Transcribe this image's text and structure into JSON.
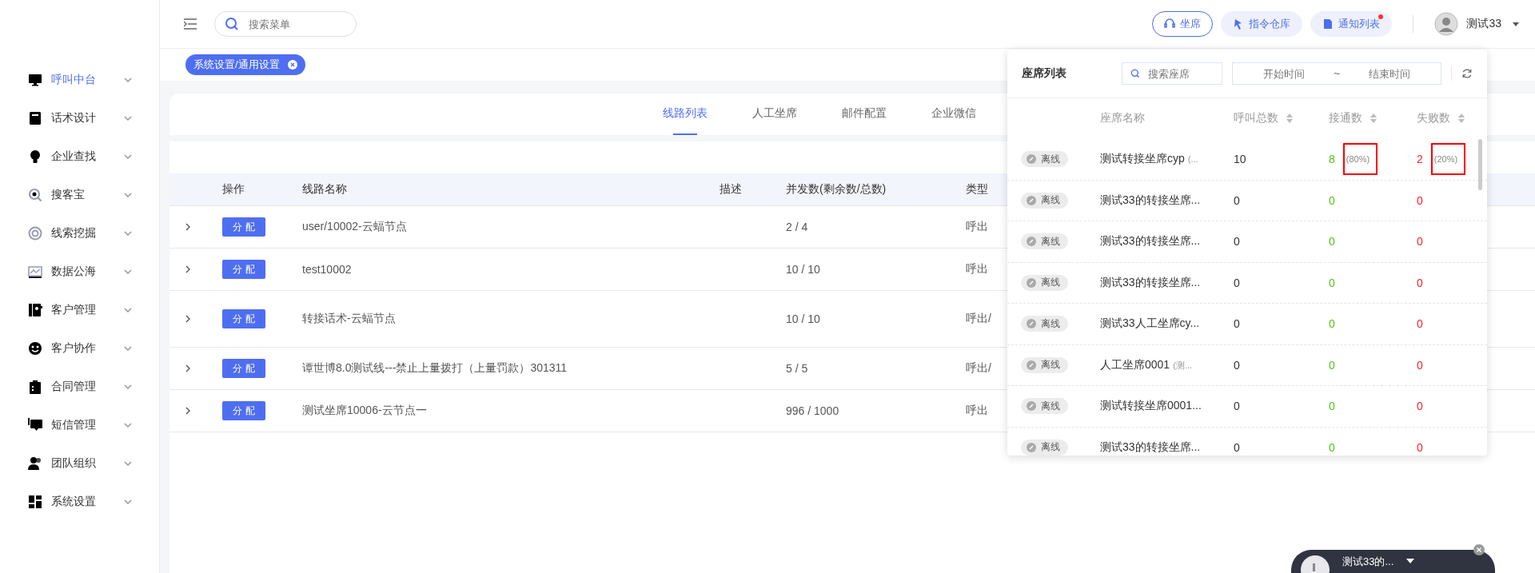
{
  "sidebar": {
    "items": [
      {
        "label": "呼叫中台",
        "selected": true
      },
      {
        "label": "话术设计",
        "selected": false
      },
      {
        "label": "企业查找",
        "selected": false
      },
      {
        "label": "搜客宝",
        "selected": false
      },
      {
        "label": "线索挖掘",
        "selected": false
      },
      {
        "label": "数据公海",
        "selected": false
      },
      {
        "label": "客户管理",
        "selected": false
      },
      {
        "label": "客户协作",
        "selected": false
      },
      {
        "label": "合同管理",
        "selected": false
      },
      {
        "label": "短信管理",
        "selected": false
      },
      {
        "label": "团队组织",
        "selected": false
      },
      {
        "label": "系统设置",
        "selected": false
      }
    ]
  },
  "header": {
    "search": {
      "placeholder": "搜索菜单"
    },
    "buttons": [
      {
        "label": "坐席",
        "selected": true,
        "dot": false
      },
      {
        "label": "指令仓库",
        "selected": false,
        "dot": false
      },
      {
        "label": "通知列表",
        "selected": false,
        "dot": true
      }
    ],
    "user": "测试33"
  },
  "tag": {
    "label": "系统设置/通用设置"
  },
  "tabs": [
    {
      "label": "线路列表",
      "selected": true
    },
    {
      "label": "人工坐席",
      "selected": false
    },
    {
      "label": "邮件配置",
      "selected": false
    },
    {
      "label": "企业微信",
      "selected": false
    }
  ],
  "table": {
    "columns": [
      "操作",
      "线路名称",
      "描述",
      "并发数(剩余数/总数)",
      "类型"
    ],
    "rows": [
      {
        "action": "分 配",
        "name": "user/10002-云蝠节点",
        "description": "",
        "concurrency": "2 / 4",
        "type": "呼出"
      },
      {
        "action": "分 配",
        "name": "test10002",
        "description": "",
        "concurrency": "10 / 10",
        "type": "呼出"
      },
      {
        "action": "分 配",
        "name": "转接话术-云蝠节点",
        "description": "",
        "concurrency": "10 / 10",
        "type": "呼出/"
      },
      {
        "action": "分 配",
        "name": "谭世博8.0测试线---禁止上量拨打（上量罚款）301311",
        "description": "",
        "concurrency": "5 / 5",
        "type": "呼出/"
      },
      {
        "action": "分 配",
        "name": "测试坐席10006-云节点一",
        "description": "",
        "concurrency": "996 / 1000",
        "type": "呼出"
      }
    ]
  },
  "seat_popup": {
    "title": "座席列表",
    "search": {
      "placeholder": "搜索座席"
    },
    "start": {
      "placeholder": "开始时间"
    },
    "separator": "~",
    "end": {
      "placeholder": "结束时间"
    },
    "columns": [
      "座席名称",
      "呼叫总数",
      "接通数",
      "失败数"
    ],
    "rows": [
      {
        "status": "离线",
        "name": "测试转接坐席cyp",
        "note": "(...",
        "total": "10",
        "connected": "8",
        "connected_pct": {
          "text": "(80%)",
          "highlighted": true
        },
        "failed": "2",
        "failed_pct": {
          "text": "(20%)",
          "highlighted": true
        }
      },
      {
        "status": "离线",
        "name": "测试33的转接坐席...",
        "total": "0",
        "connected": "0",
        "failed": "0"
      },
      {
        "status": "离线",
        "name": "测试33的转接坐席...",
        "total": "0",
        "connected": "0",
        "failed": "0"
      },
      {
        "status": "离线",
        "name": "测试33的转接坐席...",
        "total": "0",
        "connected": "0",
        "failed": "0"
      },
      {
        "status": "离线",
        "name": "测试33人工坐席cy...",
        "total": "0",
        "connected": "0",
        "failed": "0"
      },
      {
        "status": "离线",
        "name": "人工坐席0001",
        "note": "(测...",
        "total": "0",
        "connected": "0",
        "failed": "0"
      },
      {
        "status": "离线",
        "name": "测试转接坐席0001...",
        "total": "0",
        "connected": "0",
        "failed": "0"
      },
      {
        "status": "离线",
        "name": "测试33的转接坐席...",
        "total": "0",
        "connected": "0",
        "failed": "0"
      }
    ]
  },
  "call_widget": {
    "name": "测试33的..."
  }
}
